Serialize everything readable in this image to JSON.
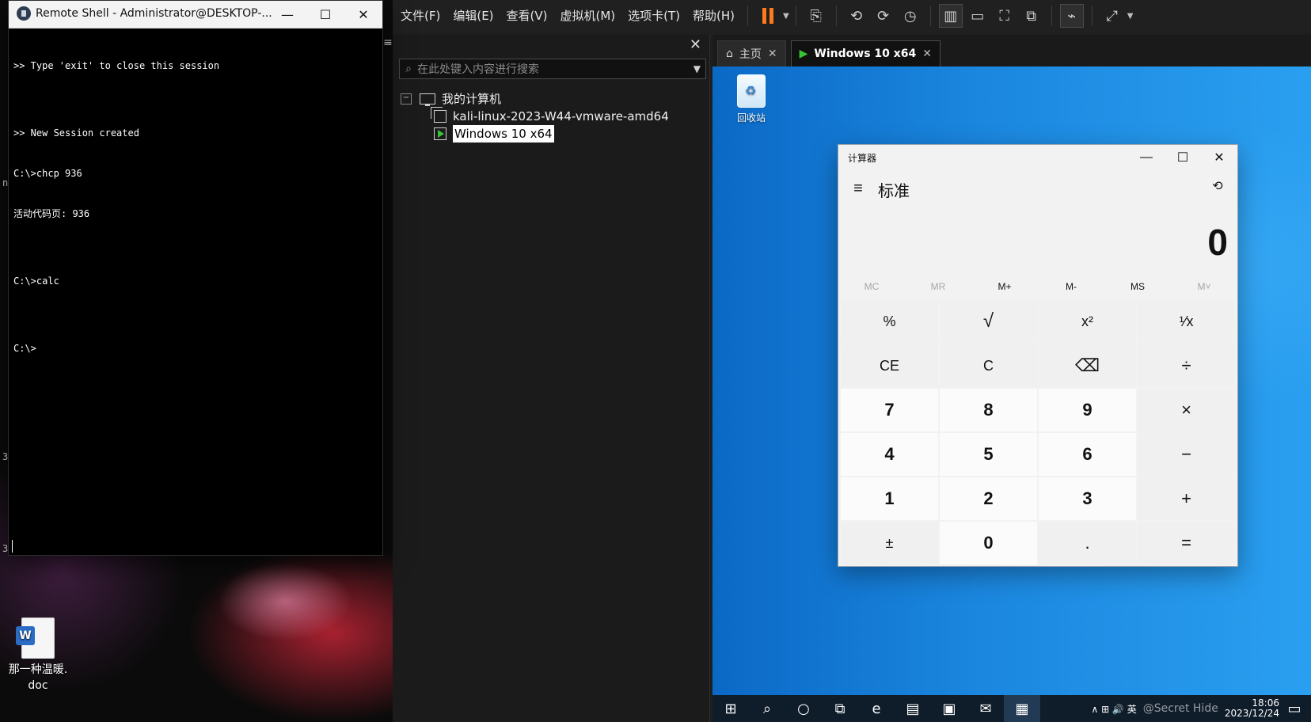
{
  "host": {
    "edge_chars": [
      "n",
      "3",
      "3"
    ],
    "desktop_icon": {
      "label_line1": "那一种温暖.",
      "label_line2": "doc",
      "icon_name": "word-document-icon"
    }
  },
  "shell_window": {
    "title": "Remote Shell - Administrator@DESKTOP-...",
    "controls": {
      "minimize": "—",
      "maximize": "☐",
      "close": "✕"
    },
    "console_lines": [
      ">> Type 'exit' to close this session",
      "",
      ">> New Session created",
      "C:\\>chcp 936",
      "活动代码页: 936",
      "",
      "C:\\>calc",
      "",
      "C:\\>"
    ]
  },
  "vmware": {
    "menu": [
      "文件(F)",
      "编辑(E)",
      "查看(V)",
      "虚拟机(M)",
      "选项卡(T)",
      "帮助(H)"
    ],
    "library": {
      "header_glyph": "≡",
      "close": "✕",
      "search_placeholder": "在此处键入内容进行搜索",
      "tree": {
        "root_label": "我的计算机",
        "items": [
          {
            "label": "kali-linux-2023-W44-vmware-amd64",
            "state": "off"
          },
          {
            "label": "Windows 10 x64",
            "state": "running",
            "selected": true
          }
        ]
      }
    },
    "vm_tabs": [
      {
        "label": "主页",
        "icon": "home-icon",
        "active": false,
        "close": "✕"
      },
      {
        "label": "Windows 10 x64",
        "icon": "vm-running-icon",
        "active": true,
        "close": "✕"
      }
    ],
    "guest": {
      "desktop_icon_label": "回收站",
      "calculator": {
        "title": "计算器",
        "mode": "标准",
        "display_value": "0",
        "controls": {
          "minimize": "—",
          "maximize": "☐",
          "close": "✕"
        },
        "memory": [
          {
            "label": "MC",
            "enabled": false
          },
          {
            "label": "MR",
            "enabled": false
          },
          {
            "label": "M+",
            "enabled": true
          },
          {
            "label": "M-",
            "enabled": true
          },
          {
            "label": "MS",
            "enabled": true
          },
          {
            "label": "M˅",
            "enabled": false
          }
        ],
        "keys": [
          [
            "%",
            "√",
            "x²",
            "¹⁄x"
          ],
          [
            "CE",
            "C",
            "⌫",
            "÷"
          ],
          [
            "7",
            "8",
            "9",
            "×"
          ],
          [
            "4",
            "5",
            "6",
            "−"
          ],
          [
            "1",
            "2",
            "3",
            "+"
          ],
          [
            "±",
            "0",
            ".",
            "="
          ]
        ]
      },
      "taskbar": {
        "tray_text": "∧ ⊞ 🔊 英",
        "watermark": "@Secret Hide",
        "time": "18:06",
        "date": "2023/12/24"
      }
    }
  }
}
